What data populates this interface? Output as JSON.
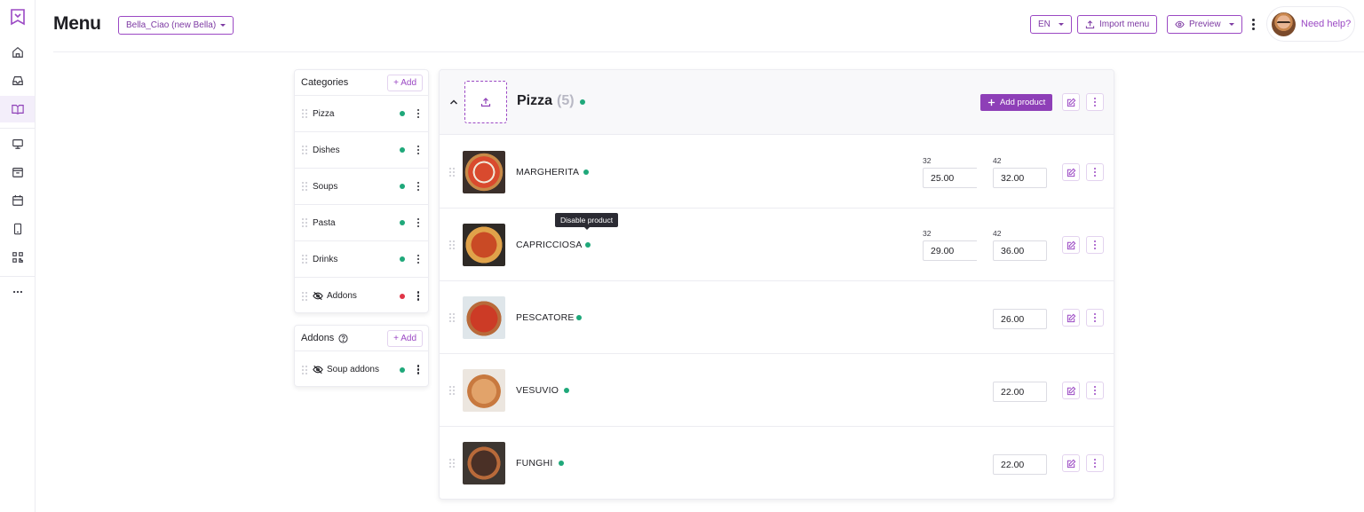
{
  "colors": {
    "accent": "#8e3fb7",
    "active_status": "#1fa87a",
    "inactive_status": "#e03547"
  },
  "rail": {
    "logo_icon": "book-logo-icon",
    "items": [
      {
        "icon": "home-icon",
        "active": false
      },
      {
        "icon": "inbox-icon",
        "active": false
      },
      {
        "icon": "book-open-icon",
        "active": true
      },
      {
        "icon": "monitor-icon",
        "active": false
      },
      {
        "icon": "box-icon",
        "active": false
      },
      {
        "icon": "calendar-icon",
        "active": false
      },
      {
        "icon": "tablet-icon",
        "active": false
      },
      {
        "icon": "qr-code-icon",
        "active": false
      },
      {
        "icon": "more-horizontal-icon",
        "active": false
      }
    ]
  },
  "header": {
    "title": "Menu",
    "venue": "Bella_Ciao (new Bella)",
    "language": "EN",
    "import_label": "Import menu",
    "preview_label": "Preview",
    "help_label": "Need help?"
  },
  "categories_panel": {
    "title": "Categories",
    "add_label": "+ Add",
    "items": [
      {
        "label": "Pizza",
        "hidden": false,
        "status": "active"
      },
      {
        "label": "Dishes",
        "hidden": false,
        "status": "active"
      },
      {
        "label": "Soups",
        "hidden": false,
        "status": "active"
      },
      {
        "label": "Pasta",
        "hidden": false,
        "status": "active"
      },
      {
        "label": "Drinks",
        "hidden": false,
        "status": "active"
      },
      {
        "label": "Addons",
        "hidden": true,
        "status": "inactive"
      }
    ]
  },
  "addons_panel": {
    "title": "Addons",
    "add_label": "+ Add",
    "items": [
      {
        "label": "Soup addons",
        "hidden": true,
        "status": "active"
      }
    ]
  },
  "category": {
    "name": "Pizza",
    "count": "(5)",
    "add_product_label": "Add product",
    "products": [
      {
        "name": "MARGHERITA",
        "prices": [
          {
            "size": "32",
            "value": "25.00"
          },
          {
            "size": "42",
            "value": "32.00"
          }
        ]
      },
      {
        "name": "CAPRICCIOSA",
        "prices": [
          {
            "size": "32",
            "value": "29.00"
          },
          {
            "size": "42",
            "value": "36.00"
          }
        ]
      },
      {
        "name": "PESCATORE",
        "prices": [
          {
            "size": "",
            "value": "26.00"
          }
        ]
      },
      {
        "name": "VESUVIO",
        "prices": [
          {
            "size": "",
            "value": "22.00"
          }
        ]
      },
      {
        "name": "FUNGHI",
        "prices": [
          {
            "size": "",
            "value": "22.00"
          }
        ]
      }
    ]
  },
  "tooltip": "Disable product"
}
